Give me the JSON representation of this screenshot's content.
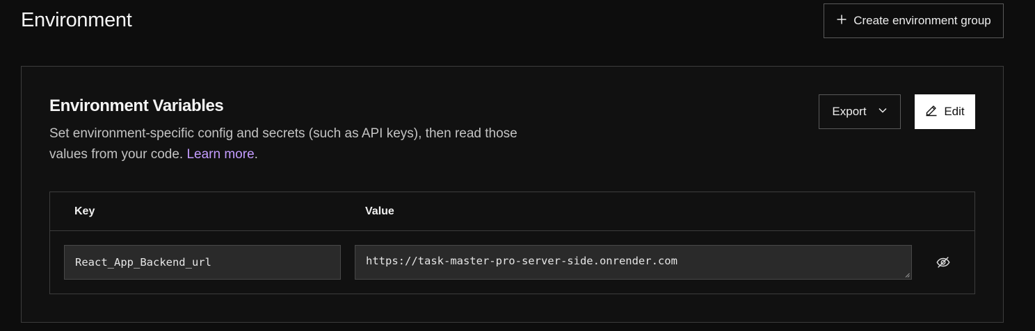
{
  "header": {
    "title": "Environment",
    "create_group_label": "Create environment group",
    "create_group_icon": "plus-icon"
  },
  "env_vars": {
    "title": "Environment Variables",
    "description": "Set environment-specific config and secrets (such as API keys), then read those values from your code.",
    "learn_more": "Learn more",
    "trailing_period": ".",
    "export_label": "Export",
    "export_icon": "chevron-down-icon",
    "edit_label": "Edit",
    "edit_icon": "pencil-icon",
    "link_color": "#c49cff",
    "table": {
      "columns": [
        "Key",
        "Value"
      ],
      "rows": [
        {
          "key": "React_App_Backend_url",
          "value": "https://task-master-pro-server-side.onrender.com",
          "visibility_icon": "eye-off-icon"
        }
      ]
    }
  }
}
